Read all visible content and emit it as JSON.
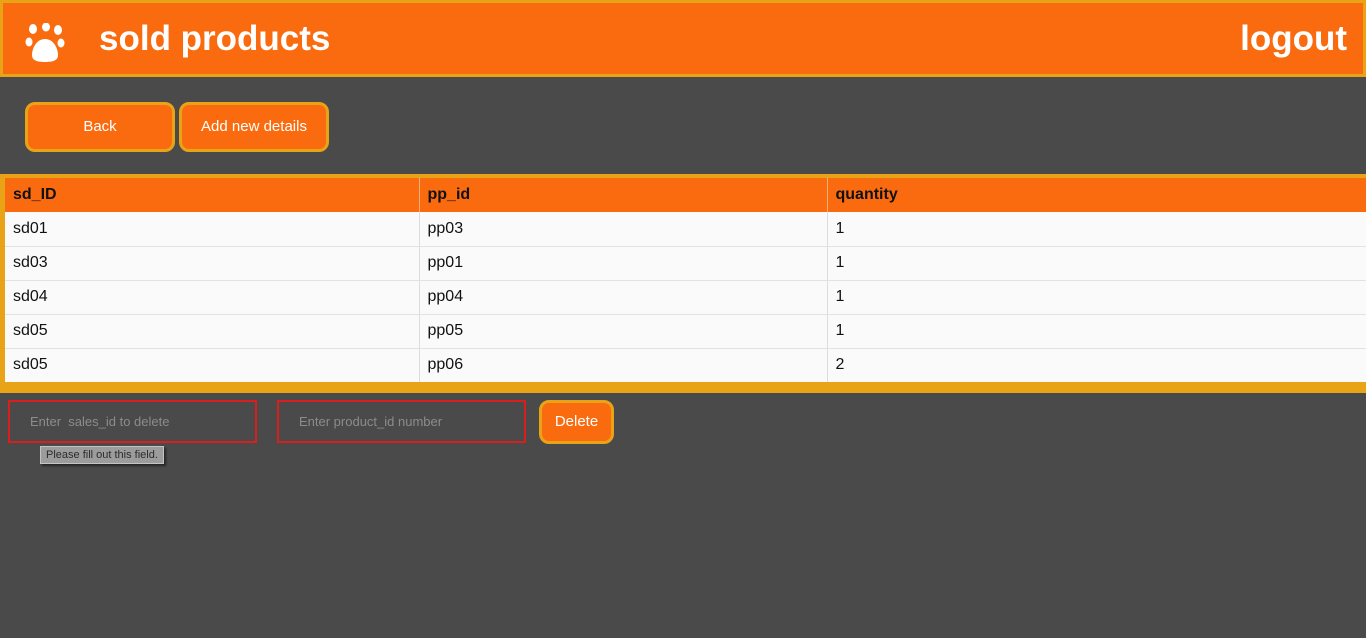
{
  "header": {
    "title": "sold products",
    "logout": "logout",
    "logo_icon": "paw-icon"
  },
  "toolbar": {
    "back_label": "Back",
    "add_label": "Add new details"
  },
  "table": {
    "columns": [
      "sd_ID",
      "pp_id",
      "quantity"
    ],
    "rows": [
      [
        "sd01",
        "pp03",
        "1"
      ],
      [
        "sd03",
        "pp01",
        "1"
      ],
      [
        "sd04",
        "pp04",
        "1"
      ],
      [
        "sd05",
        "pp05",
        "1"
      ],
      [
        "sd05",
        "pp06",
        "2"
      ]
    ]
  },
  "delete_form": {
    "sales_placeholder": "Enter  sales_id to delete",
    "product_placeholder": "Enter product_id number",
    "delete_label": "Delete",
    "validation_tooltip": "Please fill out this field."
  },
  "colors": {
    "accent": "#fa6b0f",
    "border": "#e8a317",
    "background": "#4a4a4a",
    "error": "#d91e1e"
  }
}
